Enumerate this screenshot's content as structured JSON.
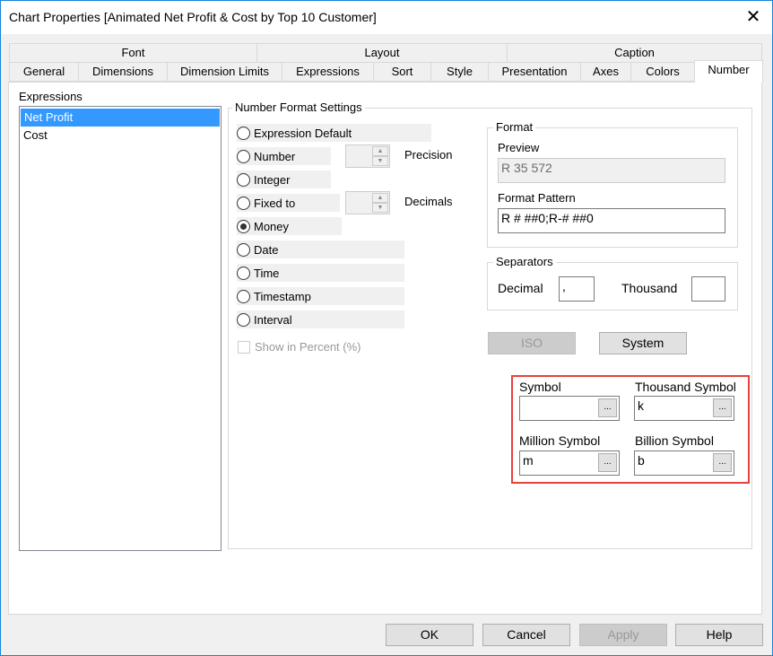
{
  "title": "Chart Properties [Animated Net Profit & Cost by Top 10 Customer]",
  "tabs_row1": [
    "Font",
    "Layout",
    "Caption"
  ],
  "tabs_row2": [
    "General",
    "Dimensions",
    "Dimension Limits",
    "Expressions",
    "Sort",
    "Style",
    "Presentation",
    "Axes",
    "Colors",
    "Number"
  ],
  "selected_tab": "Number",
  "expressions": {
    "label": "Expressions",
    "items": [
      "Net Profit",
      "Cost"
    ],
    "selected": "Net Profit"
  },
  "nfs": {
    "label": "Number Format Settings",
    "options": [
      "Expression Default",
      "Number",
      "Integer",
      "Fixed to",
      "Money",
      "Date",
      "Time",
      "Timestamp",
      "Interval"
    ],
    "selected": "Money",
    "precision": "Precision",
    "decimals": "Decimals",
    "show_percent": "Show in Percent (%)"
  },
  "format": {
    "label": "Format",
    "preview_label": "Preview",
    "preview": "R 35 572",
    "pattern_label": "Format Pattern",
    "pattern": "R # ##0;R-# ##0"
  },
  "separators": {
    "label": "Separators",
    "decimal_label": "Decimal",
    "decimal": ",",
    "thousand_label": "Thousand",
    "thousand": ""
  },
  "iso": "ISO",
  "system": "System",
  "symbols": {
    "symbol_label": "Symbol",
    "symbol": "",
    "thousand_label": "Thousand Symbol",
    "thousand": "k",
    "million_label": "Million Symbol",
    "million": "m",
    "billion_label": "Billion Symbol",
    "billion": "b",
    "browse": "..."
  },
  "highlight_color": "#e8413c",
  "buttons": {
    "ok": "OK",
    "cancel": "Cancel",
    "apply": "Apply",
    "help": "Help"
  }
}
